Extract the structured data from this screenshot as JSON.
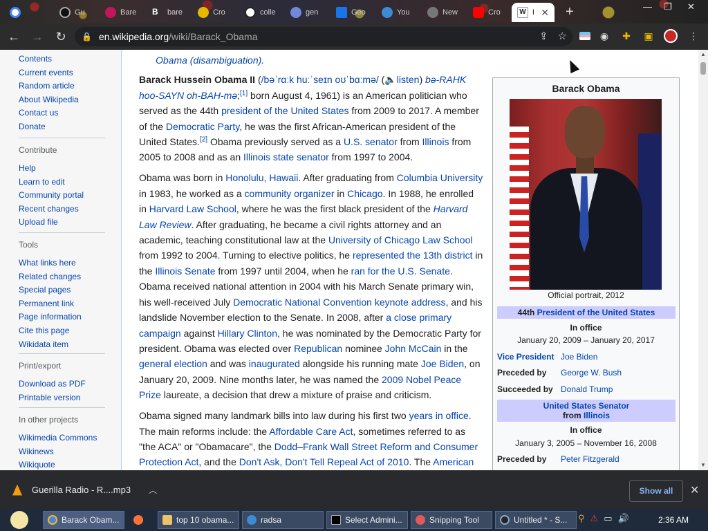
{
  "tabs": [
    {
      "title": "",
      "color": "#4285f4"
    },
    {
      "title": "Gu",
      "color": "#333333"
    },
    {
      "title": "Bare",
      "color": "#c2185b"
    },
    {
      "title": "bare",
      "color": "#555555"
    },
    {
      "title": "Cro",
      "color": "#e6b800"
    },
    {
      "title": "colle",
      "color": "#ffffff"
    },
    {
      "title": "gen",
      "color": "#7289da"
    },
    {
      "title": "Geo",
      "color": "#1a73e8"
    },
    {
      "title": "You",
      "color": "#3d8bd4"
    },
    {
      "title": "New",
      "color": "#777777"
    },
    {
      "title": "Cro",
      "color": "#ff0000"
    },
    {
      "title": "B",
      "color": "#ffffff",
      "active": true
    }
  ],
  "address": {
    "host": "en.wikipedia.org",
    "path": "/wiki/Barack_Obama"
  },
  "sidebar": {
    "main": [
      "Contents",
      "Current events",
      "Random article",
      "About Wikipedia",
      "Contact us",
      "Donate"
    ],
    "contribute": {
      "head": "Contribute",
      "items": [
        "Help",
        "Learn to edit",
        "Community portal",
        "Recent changes",
        "Upload file"
      ]
    },
    "tools": {
      "head": "Tools",
      "items": [
        "What links here",
        "Related changes",
        "Special pages",
        "Permanent link",
        "Page information",
        "Cite this page",
        "Wikidata item"
      ]
    },
    "print": {
      "head": "Print/export",
      "items": [
        "Download as PDF",
        "Printable version"
      ]
    },
    "projects": {
      "head": "In other projects",
      "items": [
        "Wikimedia Commons",
        "Wikinews",
        "Wikiquote"
      ]
    }
  },
  "article": {
    "hatnote": "Obama (disambiguation).",
    "p1": {
      "name": "Barack Hussein Obama II",
      "ipa": "/bəˈrɑːk huːˈseɪn oʊˈbɑːmə/",
      "listen": "listen",
      "respell": "bə-RAHK hoo-SAYN oh-BAH-mə",
      "ref1": "[1]",
      "t1": " born August 4, 1961) is an American politician who served as the 44th ",
      "l1": "president of the United States",
      "t2": " from 2009 to 2017. A member of the ",
      "l2": "Democratic Party",
      "t3": ", he was the first African-American president of the United States.",
      "ref2": "[2]",
      "t4": " Obama previously served as a ",
      "l3": "U.S. senator",
      "t5": " from ",
      "l4": "Illinois",
      "t6": " from 2005 to 2008 and as an ",
      "l5": "Illinois state senator",
      "t7": " from 1997 to 2004."
    },
    "p2": {
      "t1": "Obama was born in ",
      "l1": "Honolulu, Hawaii",
      "t2": ". After graduating from ",
      "l2": "Columbia University",
      "t3": " in 1983, he worked as a ",
      "l3": "community organizer",
      "t4": " in ",
      "l4": "Chicago",
      "t5": ". In 1988, he enrolled in ",
      "l5": "Harvard Law School",
      "t6": ", where he was the first black president of the ",
      "l6": "Harvard Law Review",
      "t7": ". After graduating, he became a civil rights attorney and an academic, teaching constitutional law at the ",
      "l7": "University of Chicago Law School",
      "t8": " from 1992 to 2004. Turning to elective politics, he ",
      "l8": "represented the 13th district",
      "t9": " in the ",
      "l9": "Illinois Senate",
      "t10": " from 1997 until 2004, when he ",
      "l10": "ran for the U.S. Senate",
      "t11": ". Obama received national attention in 2004 with his March Senate primary win, his well-received July ",
      "l11": "Democratic National Convention keynote address",
      "t12": ", and his landslide November election to the Senate. In 2008, after ",
      "l12": "a close primary campaign",
      "t13": " against ",
      "l13": "Hillary Clinton",
      "t14": ", he was nominated by the Democratic Party for president. Obama was elected over ",
      "l14": "Republican",
      "t15": " nominee ",
      "l15": "John McCain",
      "t16": " in the ",
      "l16": "general election",
      "t17": " and was ",
      "l17": "inaugurated",
      "t18": " alongside his running mate ",
      "l18": "Joe Biden",
      "t19": ", on January 20, 2009. Nine months later, he was named the ",
      "l19": "2009 Nobel Peace Prize",
      "t20": " laureate, a decision that drew a mixture of praise and criticism."
    },
    "p3": {
      "t1": "Obama signed many landmark bills into law during his first two ",
      "l1": "years in office",
      "t2": ". The main reforms include: the ",
      "l2": "Affordable Care Act",
      "t3": ", sometimes referred to as \"the ACA\" or \"Obamacare\", the ",
      "l3": "Dodd–Frank Wall Street Reform and Consumer Protection Act",
      "t4": ", and the ",
      "l4": "Don't Ask, Don't Tell Repeal Act of 2010",
      "t5": ". The ",
      "l5": "American"
    }
  },
  "infobox": {
    "title": "Barack Obama",
    "caption": "Official portrait, 2012",
    "band1_pre": "44th ",
    "band1_link": "President of the United States",
    "inoffice": "In office",
    "term1": "January 20, 2009 – January 20, 2017",
    "vp_k": "Vice President",
    "vp_v": "Joe Biden",
    "pre_k": "Preceded by",
    "pre_v": "George W. Bush",
    "suc_k": "Succeeded by",
    "suc_v": "Donald Trump",
    "band2_link1": "United States Senator",
    "band2_from": "from ",
    "band2_link2": "Illinois",
    "inoffice2": "In office",
    "term2": "January 3, 2005 – November 16, 2008",
    "pre2_k": "Preceded by",
    "pre2_v": "Peter Fitzgerald"
  },
  "download": {
    "file": "Guerilla Radio - R....mp3",
    "show_all": "Show all"
  },
  "taskbar": {
    "items": [
      "Barack Obam...",
      "",
      "top 10 obama...",
      "radsa",
      "Select Admini...",
      "Snipping Tool",
      "Untitled * - S..."
    ],
    "clock": "2:36 AM"
  }
}
